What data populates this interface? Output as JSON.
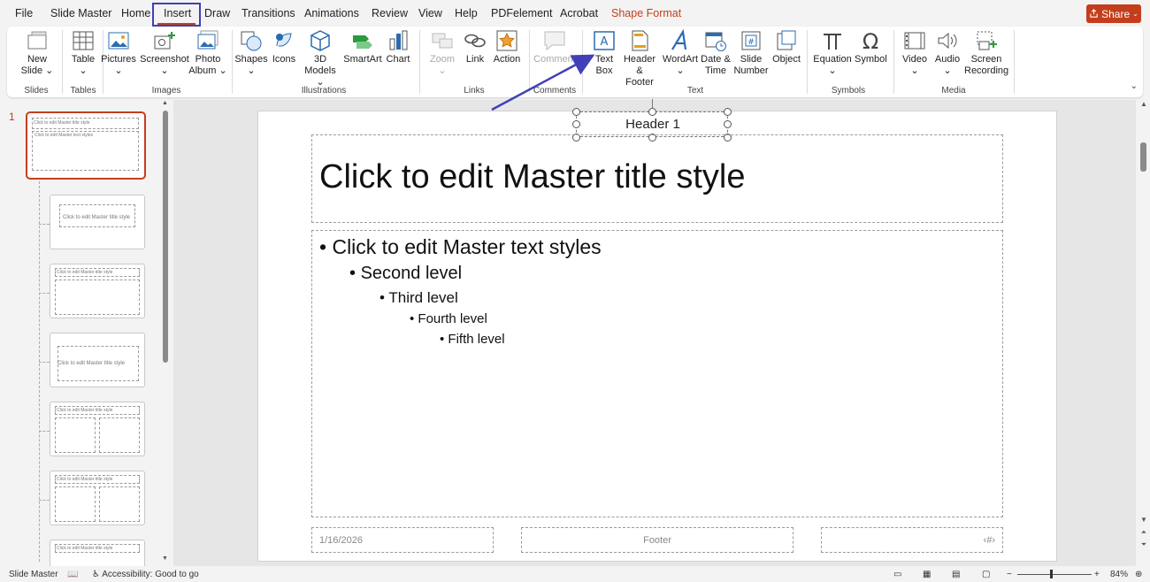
{
  "menu": {
    "file": "File",
    "slide_master": "Slide Master",
    "home": "Home",
    "insert": "Insert",
    "draw": "Draw",
    "transitions": "Transitions",
    "animations": "Animations",
    "review": "Review",
    "view": "View",
    "help": "Help",
    "pdfelement": "PDFelement",
    "acrobat": "Acrobat",
    "shape_format": "Shape Format",
    "share": "Share"
  },
  "ribbon": {
    "new_slide": "New",
    "new_slide2": "Slide",
    "table": "Table",
    "pictures": "Pictures",
    "screenshot": "Screenshot",
    "photo_album": "Photo",
    "photo_album2": "Album",
    "shapes": "Shapes",
    "icons": "Icons",
    "models_3d": "3D",
    "models_3d2": "Models",
    "smartart": "SmartArt",
    "chart": "Chart",
    "zoom": "Zoom",
    "link": "Link",
    "action": "Action",
    "comment": "Comment",
    "text_box": "Text",
    "text_box2": "Box",
    "header_footer": "Header",
    "header_footer2": "& Footer",
    "wordart": "WordArt",
    "date_time": "Date &",
    "date_time2": "Time",
    "slide_number": "Slide",
    "slide_number2": "Number",
    "object": "Object",
    "equation": "Equation",
    "symbol": "Symbol",
    "video": "Video",
    "audio": "Audio",
    "screen_recording": "Screen",
    "screen_recording2": "Recording",
    "groups": {
      "slides": "Slides",
      "tables": "Tables",
      "images": "Images",
      "illustrations": "Illustrations",
      "links": "Links",
      "comments": "Comments",
      "text": "Text",
      "symbols": "Symbols",
      "media": "Media"
    }
  },
  "thumbnails": {
    "slide_number": "1",
    "mini_title": "Click to edit Master title style",
    "mini_body": "Click to edit Master text styles"
  },
  "slide": {
    "header": "Header 1",
    "title": "Click to edit Master title style",
    "levels": [
      "Click to edit Master text styles",
      "Second level",
      "Third level",
      "Fourth level",
      "Fifth level"
    ],
    "date": "1/16/2026",
    "footer": "Footer",
    "number": "‹#›"
  },
  "status": {
    "view": "Slide Master",
    "accessibility": "Accessibility: Good to go",
    "zoom": "84%"
  },
  "colors": {
    "accent": "#c43e1c",
    "highlight": "#4040b8",
    "icon_blue": "#2b6cb0"
  }
}
